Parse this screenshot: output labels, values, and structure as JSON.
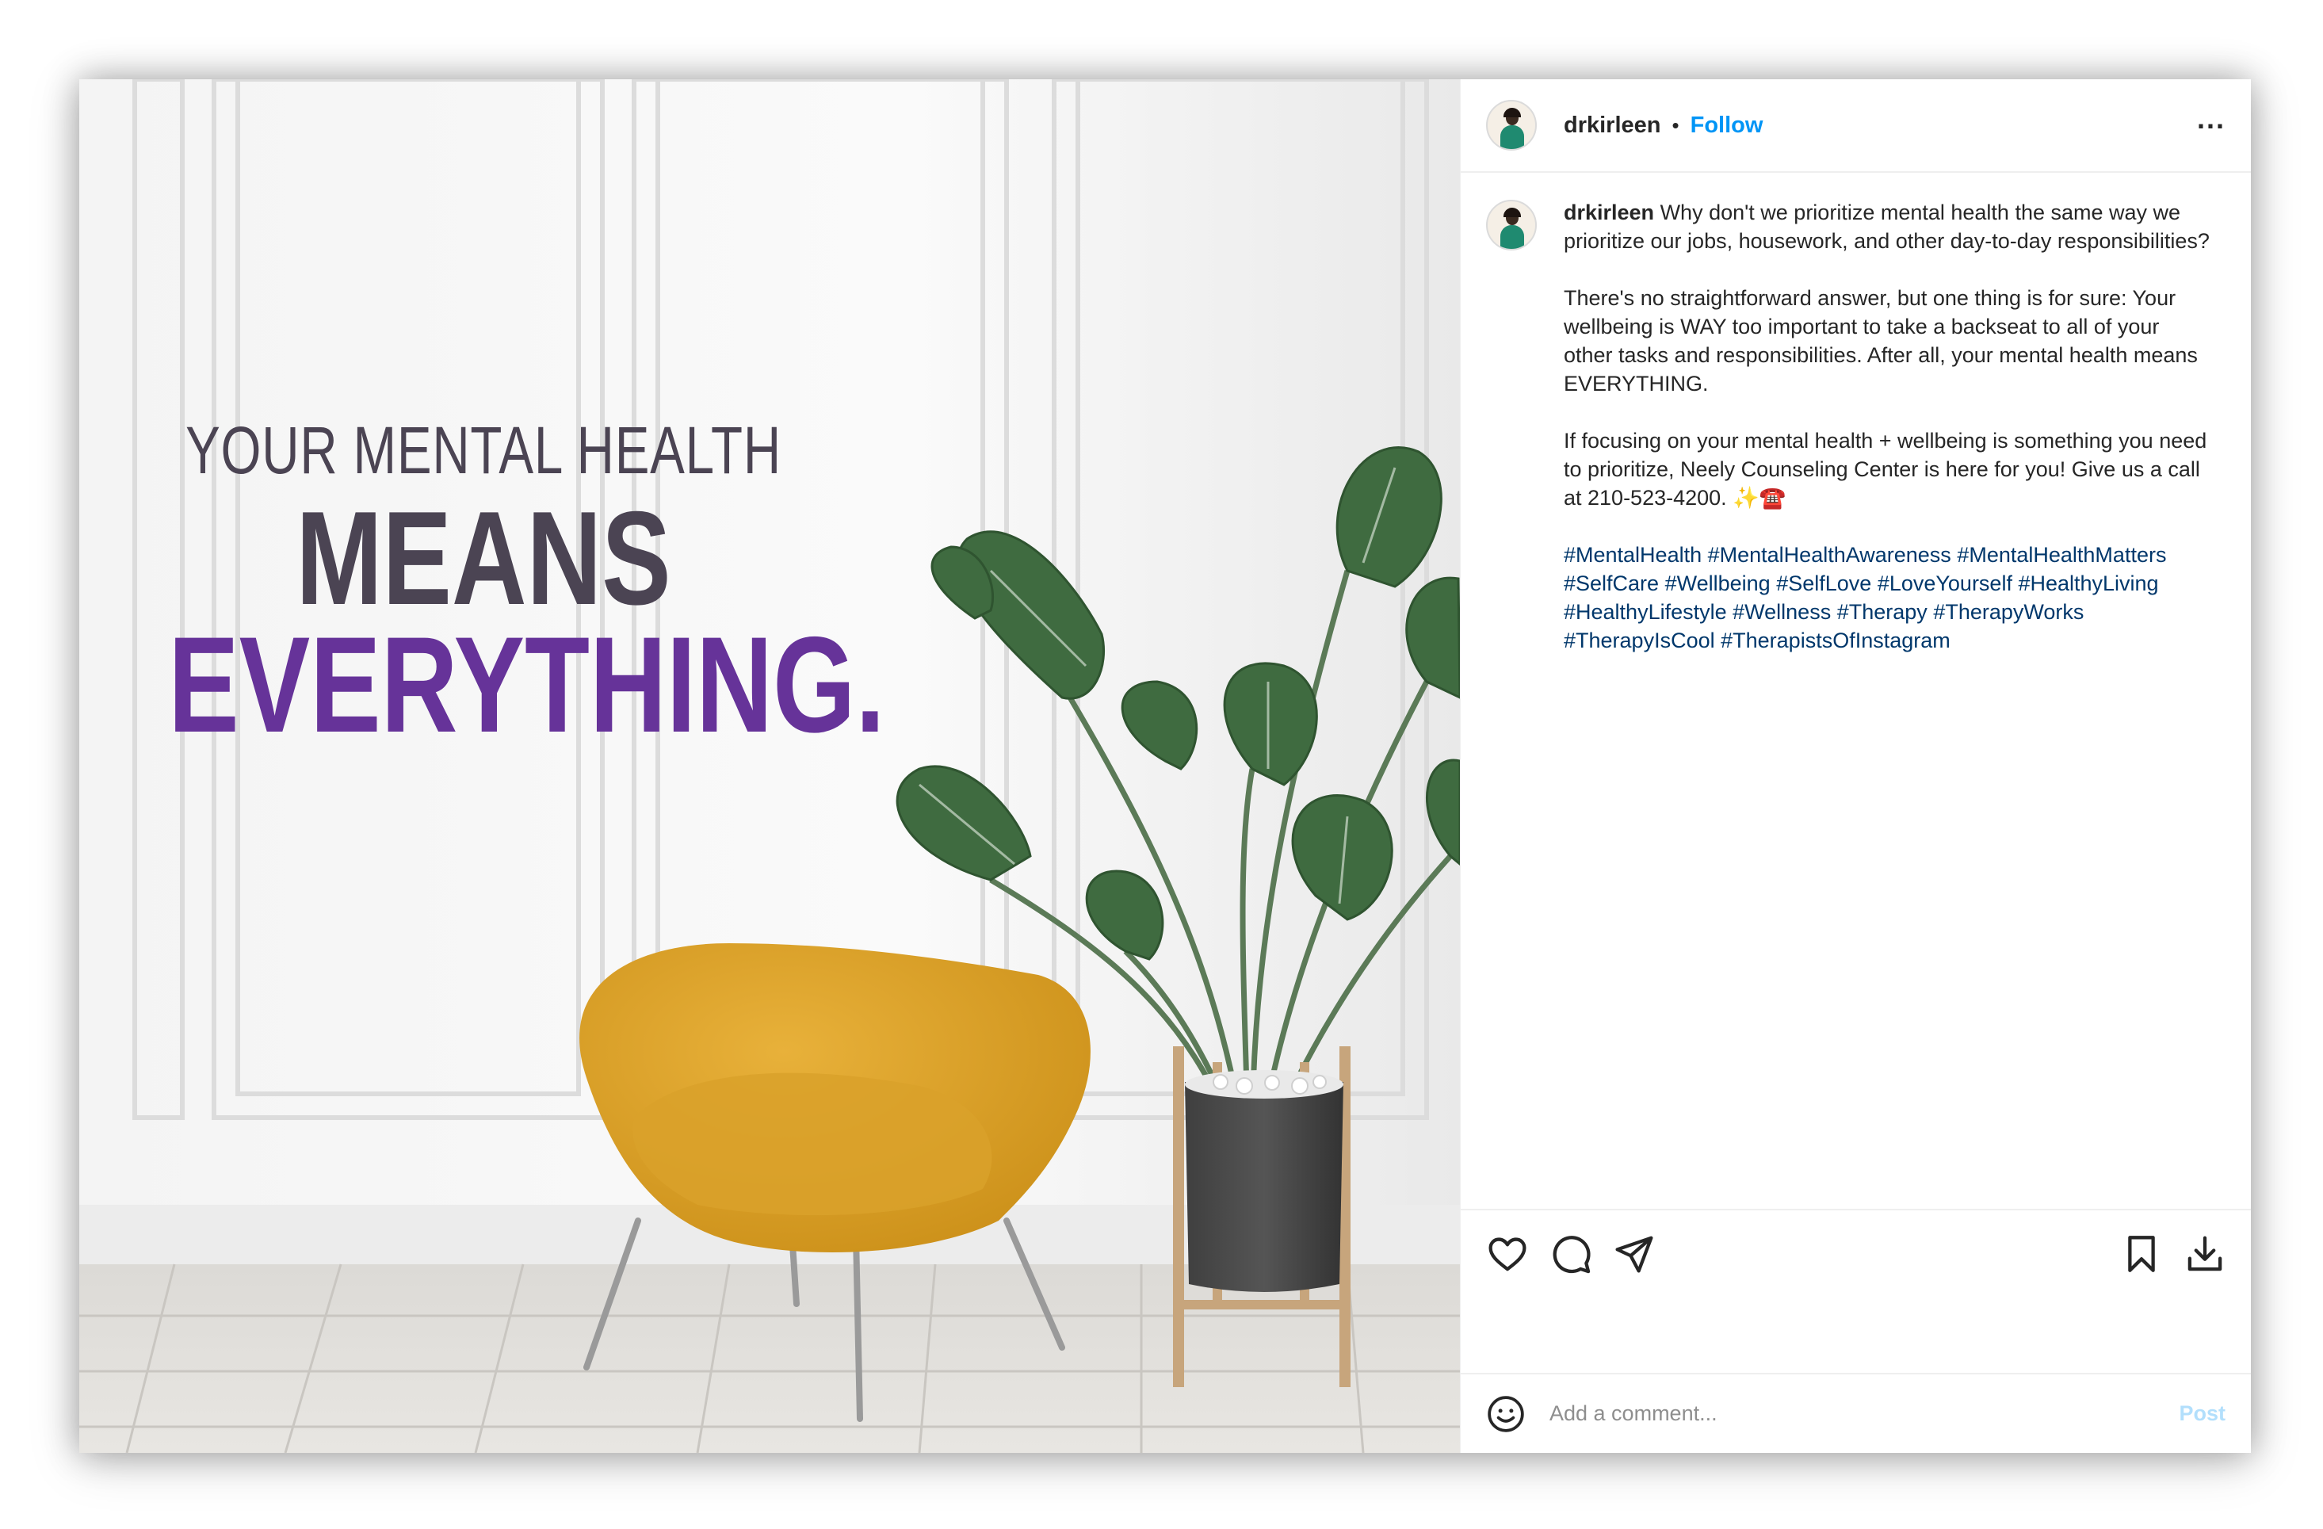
{
  "post_image": {
    "headline_line1": "YOUR MENTAL HEALTH",
    "headline_line2": "MEANS",
    "headline_line3": "EVERYTHING."
  },
  "header": {
    "username": "drkirleen",
    "separator": "•",
    "follow_label": "Follow",
    "more_label": "..."
  },
  "caption": {
    "username": "drkirleen",
    "paragraph1": "Why don't we prioritize mental health the same way we prioritize our jobs, housework, and other day-to-day responsibilities?",
    "paragraph2": "There's no straightforward answer, but one thing is for sure: Your wellbeing is WAY too important to take a backseat to all of your other tasks and responsibilities. After all, your mental health means EVERYTHING.",
    "paragraph3": "If focusing on your mental health + wellbeing is something you need to prioritize, Neely Counseling Center is here for you! Give us a call at 210-523-4200. ✨☎️",
    "hashtags": [
      "#MentalHealth",
      "#MentalHealthAwareness",
      "#MentalHealthMatters",
      "#SelfCare",
      "#Wellbeing",
      "#SelfLove",
      "#LoveYourself",
      "#HealthyLiving",
      "#HealthyLifestyle",
      "#Wellness",
      "#Therapy",
      "#TherapyWorks",
      "#TherapyIsCool",
      "#TherapistsOfInstagram"
    ]
  },
  "actions": {
    "like_icon": "heart-icon",
    "comment_icon": "comment-icon",
    "share_icon": "paper-plane-icon",
    "save_icon": "bookmark-icon",
    "download_icon": "download-icon"
  },
  "comment_box": {
    "placeholder": "Add a comment...",
    "post_label": "Post"
  },
  "colors": {
    "follow": "#0095f6",
    "hashtag": "#00376b",
    "headline_purple": "#663399",
    "headline_gray": "#4b4453",
    "post_disabled": "#b2dffc"
  }
}
